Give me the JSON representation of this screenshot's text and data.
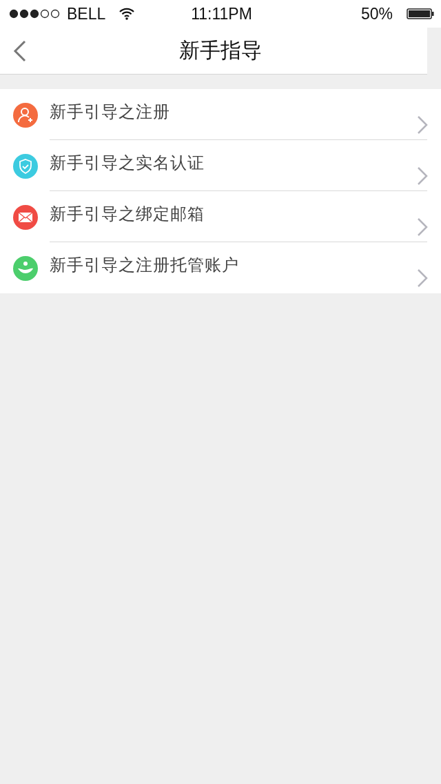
{
  "status_bar": {
    "carrier": "BELL",
    "time": "11:11PM",
    "battery": "50%"
  },
  "nav_bar": {
    "title": "新手指导"
  },
  "guide_list": [
    {
      "label": "新手引导之注册",
      "kind": "person",
      "color": "#f46b3f"
    },
    {
      "label": "新手引导之实名认证",
      "kind": "shield",
      "color": "#3ccbe0"
    },
    {
      "label": "新手引导之绑定邮箱",
      "kind": "mail",
      "color": "#f04b44"
    },
    {
      "label": "新手引导之注册托管账户",
      "kind": "hand",
      "color": "#4cce6c"
    }
  ]
}
